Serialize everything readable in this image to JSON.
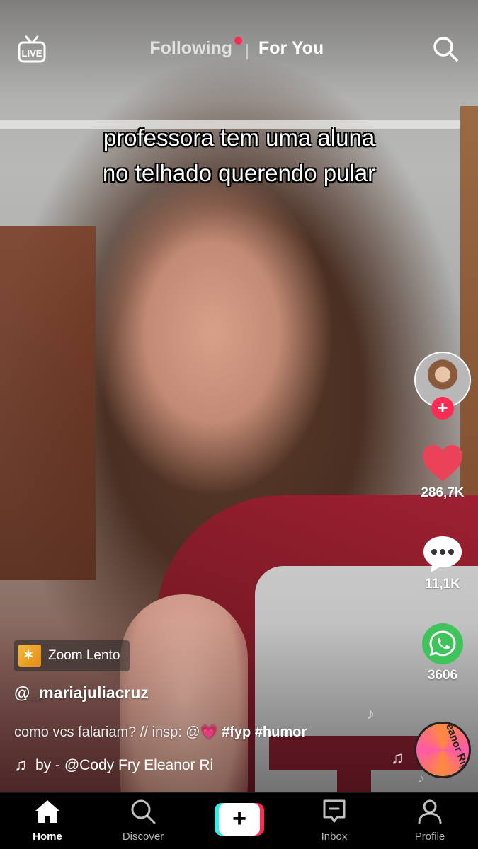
{
  "top_bar": {
    "live_label": "LIVE",
    "tabs": [
      {
        "label": "Following",
        "active": false,
        "has_dot": true
      },
      {
        "label": "For You",
        "active": true
      }
    ]
  },
  "video": {
    "caption_line1": "professora tem uma aluna",
    "caption_line2": "no telhado querendo pular"
  },
  "right_rail": {
    "likes": "286,7K",
    "comments": "11,1K",
    "shares": "3606",
    "follow_symbol": "+",
    "disc_label": "Eleanor Rigby"
  },
  "post": {
    "effect_label": "Zoom Lento",
    "username": "@_mariajuliacruz",
    "description_text": "como vcs falariam? // insp: @",
    "description_emoji": "💗",
    "hashtags": [
      "#fyp",
      "#humor"
    ],
    "music": "by - @Cody Fry     Eleanor Ri"
  },
  "bottom_nav": {
    "items": [
      {
        "label": "Home",
        "active": true
      },
      {
        "label": "Discover",
        "active": false
      },
      {
        "label": "Inbox",
        "active": false
      },
      {
        "label": "Profile",
        "active": false
      }
    ],
    "create_symbol": "+"
  },
  "colors": {
    "accent_red": "#fe2c55",
    "accent_cyan": "#25f4ee",
    "like_heart": "#ea4359",
    "whatsapp_green": "#3ec45b"
  }
}
